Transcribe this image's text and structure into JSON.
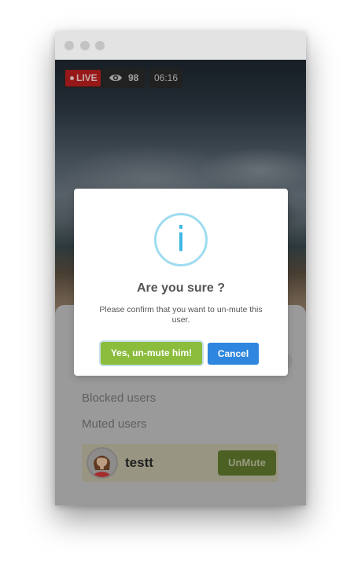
{
  "stream": {
    "live_label": "LIVE",
    "viewer_count": "98",
    "duration": "06:16"
  },
  "panel": {
    "blocked_users_label": "Blocked users",
    "muted_users_label": "Muted users",
    "muted_users": [
      {
        "name": "testt",
        "action_label": "UnMute"
      }
    ]
  },
  "dialog": {
    "icon": "info-icon",
    "icon_glyph": "i",
    "title": "Are you sure ?",
    "message": "Please confirm that you want to un-mute this user.",
    "confirm_label": "Yes, un-mute him!",
    "cancel_label": "Cancel"
  },
  "colors": {
    "live_red": "#c21f1f",
    "confirm_green": "#8bbc3c",
    "cancel_blue": "#2e86de",
    "info_blue": "#3fb8e4"
  }
}
